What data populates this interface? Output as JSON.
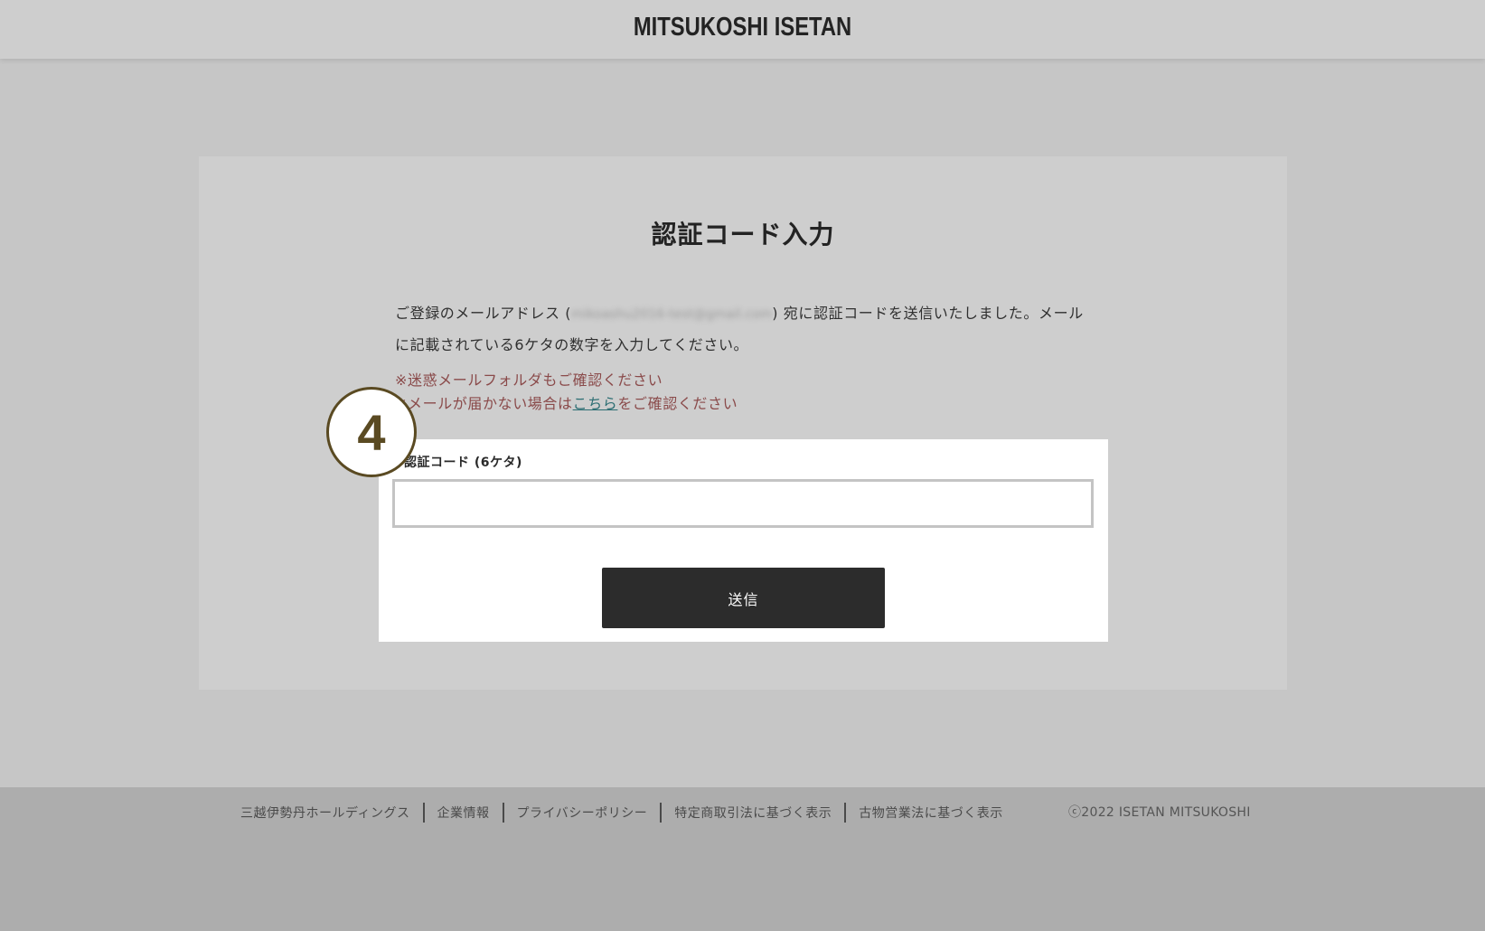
{
  "header": {
    "logo": "MITSUKOSHI ISETAN"
  },
  "page": {
    "title": "認証コード入力",
    "desc_prefix": "ご登録のメールアドレス (",
    "email_masked": "mikoashu2016-test@gmail.com",
    "desc_suffix": ") 宛に認証コードを送信いたしました。メールに記載されている6ケタの数字を入力してください。"
  },
  "notes": {
    "line1": "※迷惑メールフォルダもご確認ください",
    "line2_prefix": "※メールが届かない場合は",
    "line2_link": "こちら",
    "line2_suffix": "をご確認ください"
  },
  "form": {
    "code_label": "認証コード (6ケタ)",
    "code_value": "",
    "submit_label": "送信"
  },
  "annotation": {
    "step_number": "4"
  },
  "footer": {
    "links": [
      "三越伊勢丹ホールディングス",
      "企業情報",
      "プライバシーポリシー",
      "特定商取引法に基づく表示",
      "古物営業法に基づく表示"
    ],
    "copyright": "ⓒ2022 ISETAN MITSUKOSHI"
  }
}
